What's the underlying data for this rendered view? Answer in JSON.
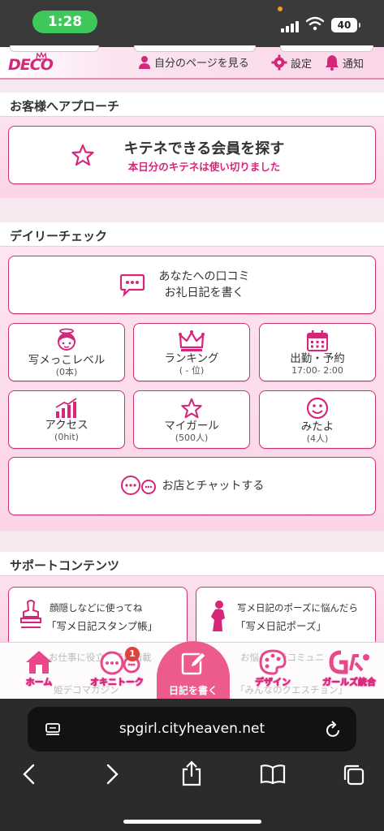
{
  "status": {
    "time": "1:28",
    "battery": "40"
  },
  "topnav": {
    "logo": "DECO",
    "my_page": "自分のページを見る",
    "settings": "設定",
    "notifications": "通知"
  },
  "approach": {
    "heading": "お客様へアプローチ",
    "search_title": "キテネできる会員を探す",
    "search_sub": "本日分のキテネは使い切りました"
  },
  "daily": {
    "heading": "デイリーチェック",
    "review_line1": "あなたへの口コミ",
    "review_line2": "お礼日記を書く",
    "tiles": [
      {
        "label": "写メっこレベル",
        "sub": "(0本)"
      },
      {
        "label": "ランキング",
        "sub": "( - 位)"
      },
      {
        "label": "出勤・予約",
        "sub": "17:00- 2:00"
      },
      {
        "label": "アクセス",
        "sub": "(0hit)"
      },
      {
        "label": "マイガール",
        "sub": "(500人)"
      },
      {
        "label": "みたよ",
        "sub": "(4人)"
      }
    ],
    "chat": "お店とチャットする"
  },
  "support": {
    "heading": "サポートコンテンツ",
    "stamp_line1": "顔隠しなどに使ってね",
    "stamp_line2": "「写メ日記スタンプ帳」",
    "pose_line1": "写メ日記のポーズに悩んだら",
    "pose_line2": "「写メ日記ポーズ」",
    "faded_left_1": "お仕事に役立つ情報満載",
    "faded_left_2": "姫デコマガジン",
    "faded_right_1": "お悩み相談コミュニ",
    "faded_right_2": "「みんなのクエスチョン」"
  },
  "bottom_nav": {
    "home": "ホーム",
    "talk": "オキニトーク",
    "talk_badge": "1",
    "write": "日記を書く",
    "design": "デザイン",
    "girls": "ガールズ統合"
  },
  "browser": {
    "url": "spgirl.cityheaven.net"
  },
  "colors": {
    "accent": "#d6267a",
    "border": "#c9346f",
    "button": "#ec5b8a"
  }
}
